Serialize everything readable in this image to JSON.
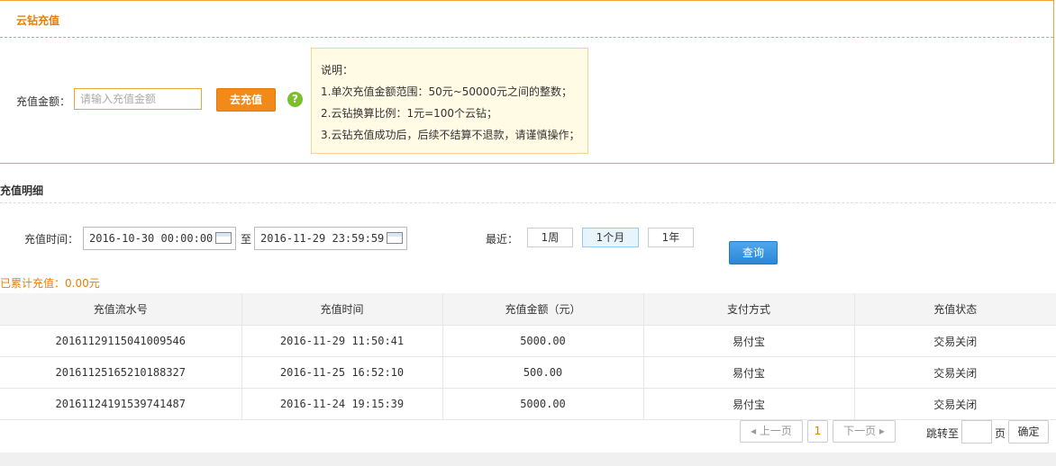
{
  "panel": {
    "title": "云钻充值",
    "amount_label": "充值金额：",
    "amount_placeholder": "请输入充值金额",
    "amount_value": "",
    "recharge_button": "去充值",
    "help_glyph": "?",
    "notes": {
      "heading": "说明：",
      "lines": [
        "1.单次充值金额范围：50元~50000元之间的整数；",
        "2.云钻换算比例：1元=100个云钻；",
        "3.云钻充值成功后，后续不结算不退款，请谨慎操作；"
      ]
    }
  },
  "details": {
    "title": "充值明细",
    "time_label": "充值时间：",
    "start_date": "2016-10-30 00:00:00",
    "to_label": "至",
    "end_date": "2016-11-29 23:59:59",
    "recent_label": "最近：",
    "ranges": [
      {
        "label": "1周",
        "active": false
      },
      {
        "label": "1个月",
        "active": true
      },
      {
        "label": "1年",
        "active": false
      }
    ],
    "query_button": "查询",
    "total_text": "已累计充值：0.00元"
  },
  "table": {
    "headers": [
      "充值流水号",
      "充值时间",
      "充值金额（元）",
      "支付方式",
      "充值状态"
    ],
    "rows": [
      [
        "20161129115041009546",
        "2016-11-29 11:50:41",
        "5000.00",
        "易付宝",
        "交易关闭"
      ],
      [
        "20161125165210188327",
        "2016-11-25 16:52:10",
        "500.00",
        "易付宝",
        "交易关闭"
      ],
      [
        "20161124191539741487",
        "2016-11-24 19:15:39",
        "5000.00",
        "易付宝",
        "交易关闭"
      ]
    ]
  },
  "pagination": {
    "prev": "上一页",
    "current": "1",
    "next": "下一页",
    "jump_label": "跳转至",
    "page_unit": "页",
    "confirm": "确定"
  }
}
